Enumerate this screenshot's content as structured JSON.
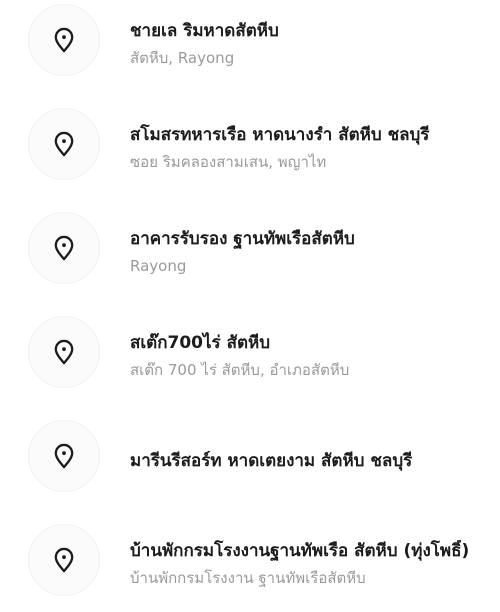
{
  "places": [
    {
      "title": "ชายเล ริมหาดสัตหีบ",
      "subtitle": "สัตหีบ, Rayong",
      "icon": "location-pin-icon"
    },
    {
      "title": "สโมสรทหารเรือ หาดนางรำ สัตหีบ ชลบุรี",
      "subtitle": "ซอย ริมคลองสามเสน, พญาไท",
      "icon": "location-pin-icon"
    },
    {
      "title": "อาคารรับรอง ฐานทัพเรือสัตหีบ",
      "subtitle": "Rayong",
      "icon": "location-pin-icon"
    },
    {
      "title": "สเต๊ก700ไร่ สัตหีบ",
      "subtitle": "สเต๊ก 700 ไร่ สัตหีบ, อำเภอสัตหีบ",
      "icon": "location-pin-icon"
    },
    {
      "title": "มารีนรีสอร์ท หาดเตยงาม สัตหีบ ชลบุรี",
      "subtitle": "",
      "icon": "location-pin-icon"
    },
    {
      "title": "บ้านพักกรมโรงงานฐานทัพเรือ สัตหีบ (ทุ่งโพธิ์)",
      "subtitle": "บ้านพักกรมโรงงาน ฐานทัพเรือสัตหีบ",
      "icon": "location-pin-icon"
    }
  ],
  "colors": {
    "title": "#1c1c1c",
    "subtitle": "#9a9a9a",
    "icon": "#1c1c1c",
    "icon_bg": "#fbfbfb"
  }
}
